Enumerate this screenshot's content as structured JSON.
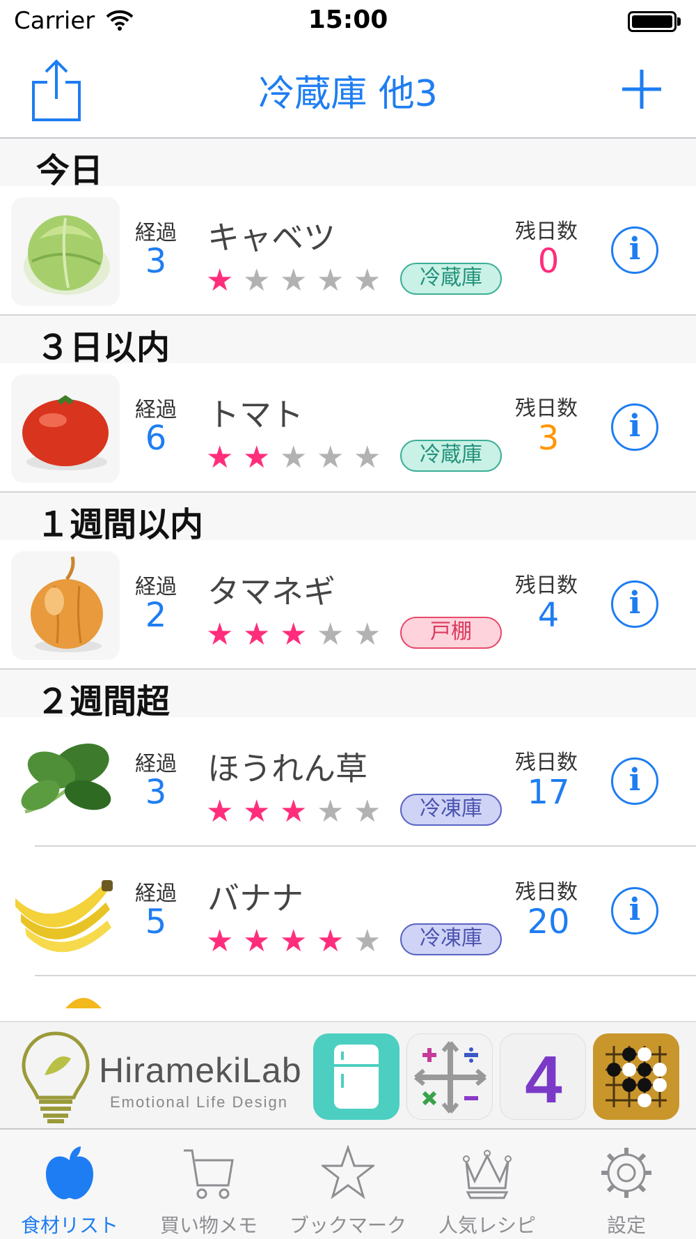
{
  "status_bar": {
    "carrier": "Carrier",
    "time": "15:00"
  },
  "nav": {
    "title": "冷蔵庫 他3"
  },
  "labels": {
    "elapsed": "経過",
    "remaining": "残日数"
  },
  "sections": [
    {
      "header": "今日",
      "items": [
        {
          "name": "キャベツ",
          "elapsed": "3",
          "remaining": "0",
          "rating": 1,
          "storage": "冷蔵庫",
          "remaining_color": "#ff2d7c"
        }
      ]
    },
    {
      "header": "３日以内",
      "items": [
        {
          "name": "トマト",
          "elapsed": "6",
          "remaining": "3",
          "rating": 2,
          "storage": "冷蔵庫",
          "remaining_color": "#ff9500"
        }
      ]
    },
    {
      "header": "１週間以内",
      "items": [
        {
          "name": "タマネギ",
          "elapsed": "2",
          "remaining": "4",
          "rating": 3,
          "storage": "戸棚",
          "remaining_color": "#1e7df2"
        }
      ]
    },
    {
      "header": "２週間超",
      "items": [
        {
          "name": "ほうれん草",
          "elapsed": "3",
          "remaining": "17",
          "rating": 3,
          "storage": "冷凍庫",
          "remaining_color": "#1e7df2"
        },
        {
          "name": "バナナ",
          "elapsed": "5",
          "remaining": "20",
          "rating": 4,
          "storage": "冷凍庫",
          "remaining_color": "#1e7df2"
        }
      ]
    }
  ],
  "storage_colors": {
    "冷蔵庫": {
      "bg": "#c9f1e6",
      "border": "#3cae96",
      "text": "#22917a"
    },
    "戸棚": {
      "bg": "#ffd3dc",
      "border": "#e64a6c",
      "text": "#d93a5e"
    },
    "冷凍庫": {
      "bg": "#cfd3f6",
      "border": "#5a63c2",
      "text": "#4a52ae"
    }
  },
  "ad": {
    "brand": "HiramekiLab",
    "tagline": "Emotional Life Design",
    "app_icon_4": "4"
  },
  "tabs": [
    {
      "label": "食材リスト",
      "icon": "apple-icon",
      "active": true
    },
    {
      "label": "買い物メモ",
      "icon": "cart-icon",
      "active": false
    },
    {
      "label": "ブックマーク",
      "icon": "star-icon",
      "active": false
    },
    {
      "label": "人気レシピ",
      "icon": "crown-icon",
      "active": false
    },
    {
      "label": "設定",
      "icon": "gear-icon",
      "active": false
    }
  ],
  "colors": {
    "accent": "#1e7df2",
    "star_on": "#ff2d7c",
    "star_off": "#b2b2b2"
  }
}
